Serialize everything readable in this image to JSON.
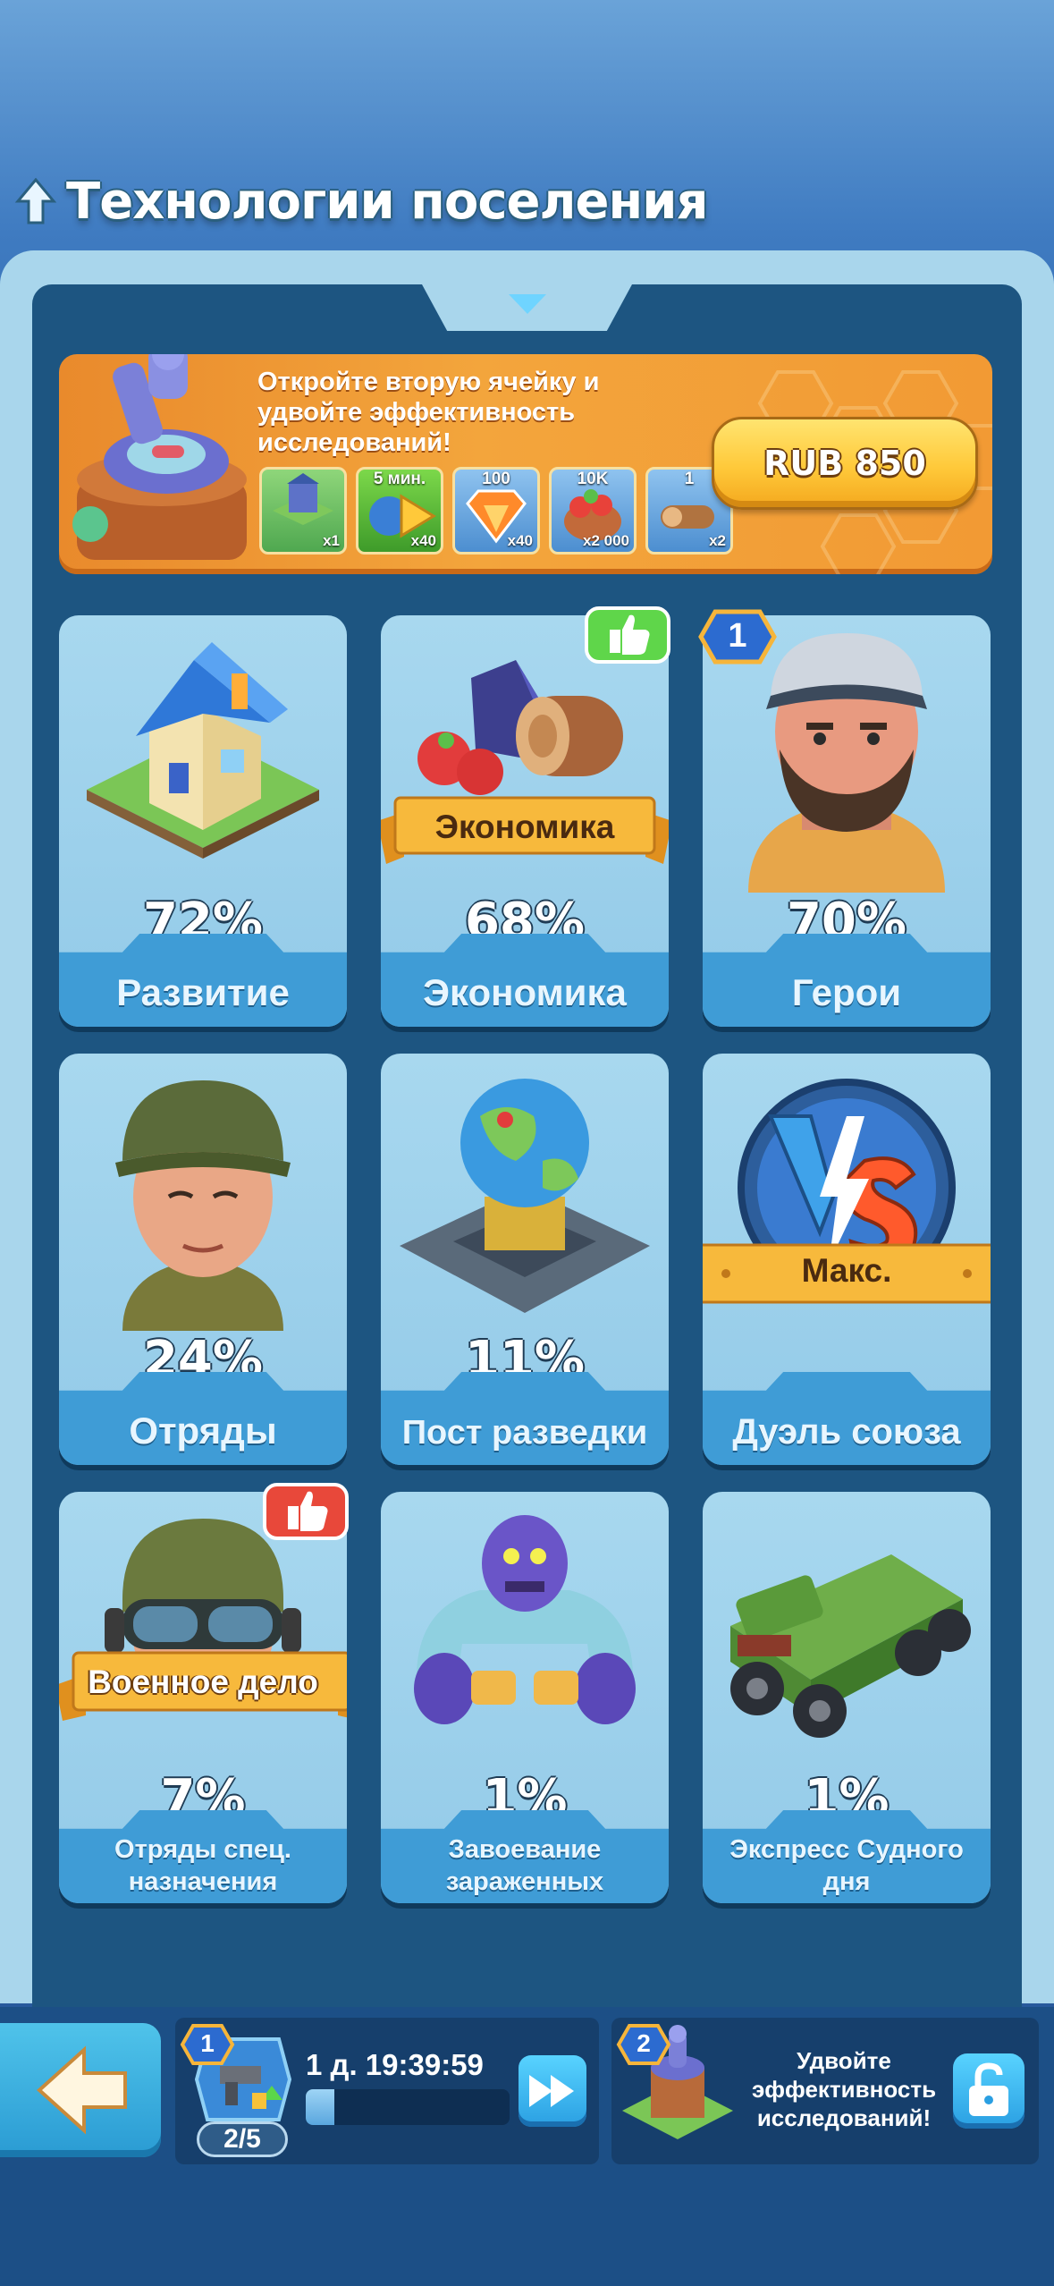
{
  "header": {
    "title": "Технологии поселения",
    "icon": "tree-icon"
  },
  "offer": {
    "text": "Откройте вторую ячейку и удвойте эффективность исследований!",
    "price_label": "RUB 850",
    "rewards": [
      {
        "name": "building-reward",
        "top": "",
        "qty": "x1"
      },
      {
        "name": "speedup-reward",
        "top": "5 мин.",
        "qty": "x40"
      },
      {
        "name": "gem-reward",
        "top": "100",
        "qty": "x40"
      },
      {
        "name": "food-reward",
        "top": "10K",
        "qty": "x2 000"
      },
      {
        "name": "wood-reward",
        "top": "1",
        "qty": "x2"
      }
    ]
  },
  "cards": [
    {
      "id": "development",
      "pct": "72%",
      "label": "Развитие"
    },
    {
      "id": "economy",
      "pct": "68%",
      "label": "Экономика",
      "ribbon": "Экономика"
    },
    {
      "id": "heroes",
      "pct": "70%",
      "label": "Герои",
      "badge": "1"
    },
    {
      "id": "troops",
      "pct": "24%",
      "label": "Отряды"
    },
    {
      "id": "scout-post",
      "pct": "11%",
      "label": "Пост разведки"
    },
    {
      "id": "alliance-duel",
      "pct": "",
      "label": "Дуэль союза",
      "ribbon": "Макс."
    },
    {
      "id": "special-forces",
      "pct": "7%",
      "label": "Отряды спец. назначения",
      "ribbon": "Военное дело"
    },
    {
      "id": "conquer-infected",
      "pct": "1%",
      "label": "Завоевание зараженных"
    },
    {
      "id": "doomsday-express",
      "pct": "1%",
      "label": "Экспресс Судного дня"
    }
  ],
  "queue": {
    "slot_number": "1",
    "timer": "1 д. 19:39:59",
    "progress": 0.14,
    "slot_count": "2/5"
  },
  "second_slot": {
    "slot_number": "2",
    "text": "Удвойте эффективность исследований!"
  },
  "colors": {
    "panel": "#1d5581",
    "card": "#a8d8ef",
    "accent": "#ffc93a",
    "ribbon": "#f5b43a"
  }
}
